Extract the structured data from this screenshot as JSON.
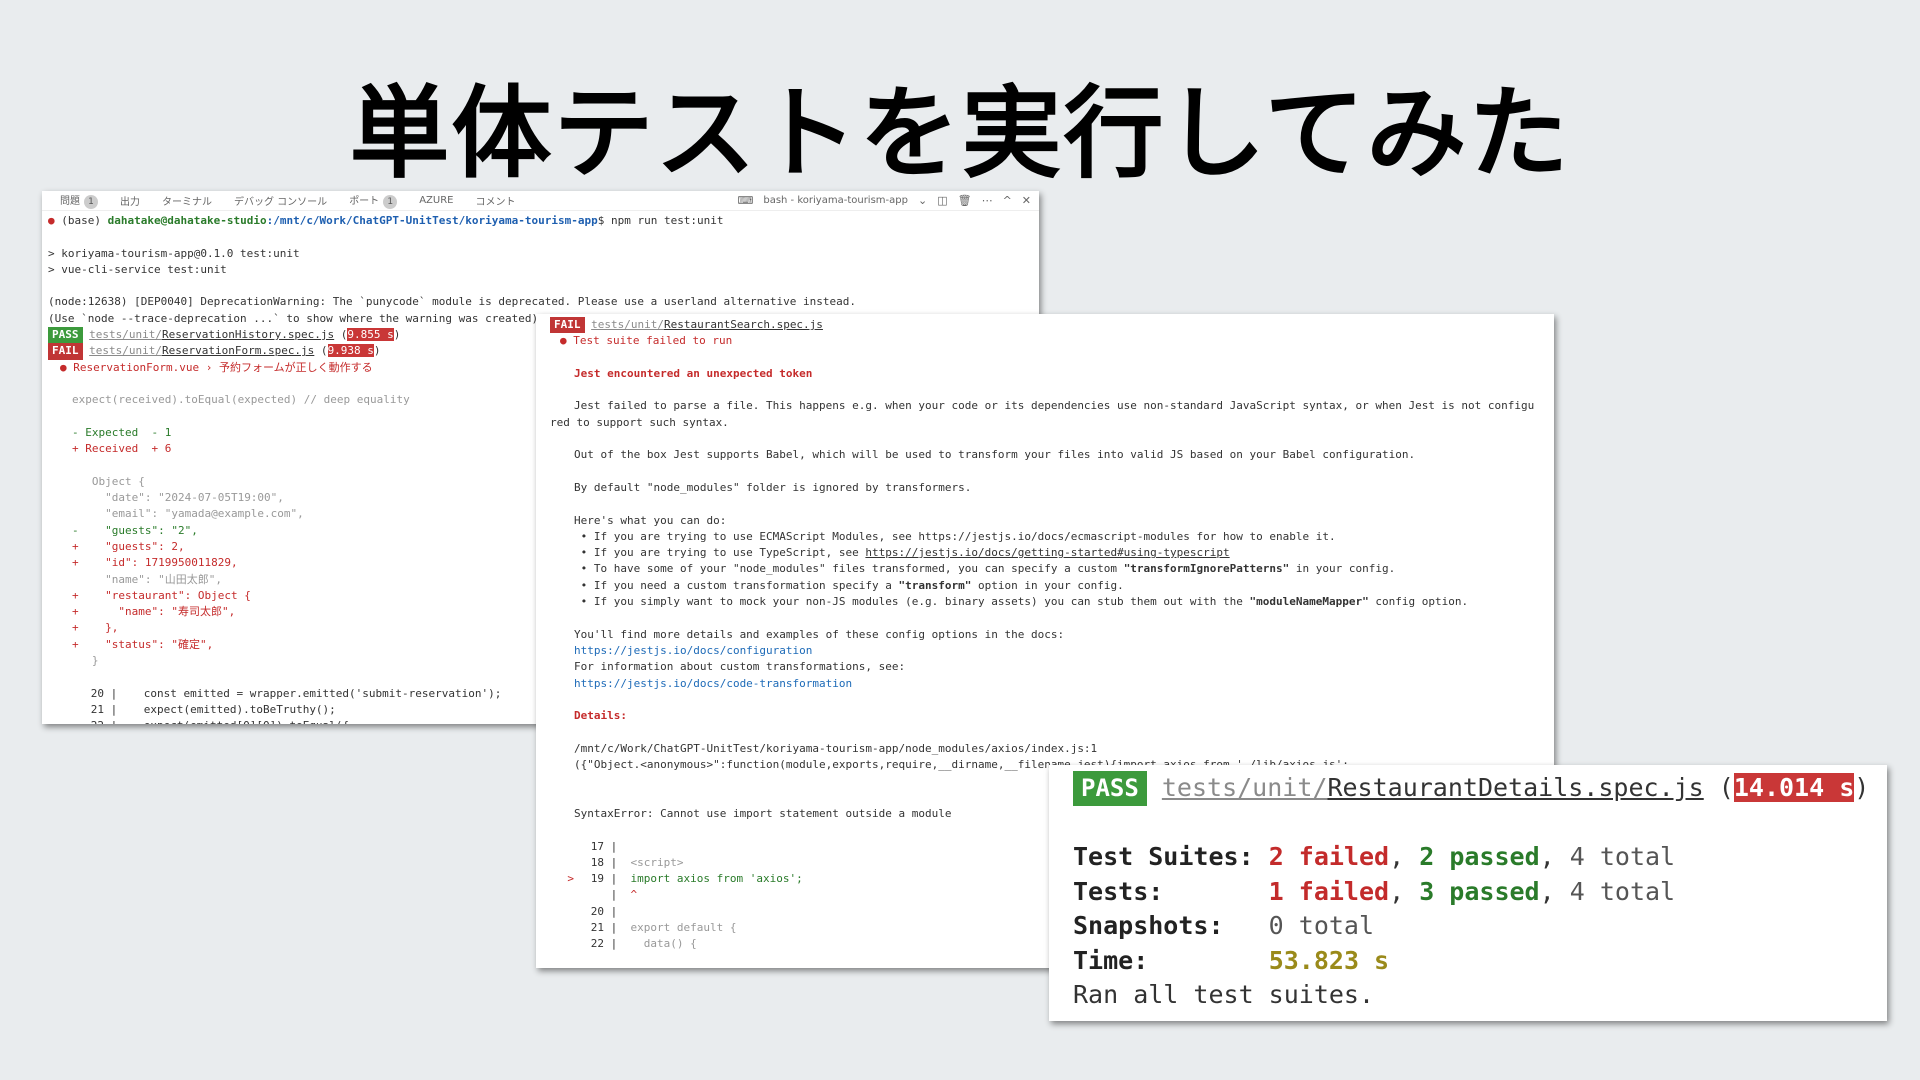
{
  "title": "単体テストを実行してみた",
  "shot1": {
    "tabs": [
      {
        "label": "問題",
        "count": "1"
      },
      {
        "label": "出力"
      },
      {
        "label": "ターミナル"
      },
      {
        "label": "デバッグ コンソール"
      },
      {
        "label": "ポート",
        "count": "1"
      },
      {
        "label": "AZURE"
      },
      {
        "label": "コメント"
      }
    ],
    "terminal_name": "bash - koriyama-tourism-app",
    "prompt_env": "(base)",
    "prompt_user": "dahatake@dahatake-studio",
    "prompt_path": ":/mnt/c/Work/ChatGPT-UnitTest/koriyama-tourism-app",
    "prompt_cmd": "$ npm run test:unit",
    "run_line1": "> koriyama-tourism-app@0.1.0 test:unit",
    "run_line2": "> vue-cli-service test:unit",
    "dep_line1": "(node:12638) [DEP0040] DeprecationWarning: The `punycode` module is deprecated. Please use a userland alternative instead.",
    "dep_line2": "(Use `node --trace-deprecation ...` to show where the warning was created)",
    "pass_label": "PASS",
    "fail_label": "FAIL",
    "pass_dir": "tests/unit/",
    "pass_file": "ReservationHistory.spec.js",
    "pass_time": "9.855 s",
    "fail_dir": "tests/unit/",
    "fail_file": "ReservationForm.spec.js",
    "fail_time": "9.938 s",
    "fail_test": "● ReservationForm.vue › 予約フォームが正しく動作する",
    "expect_line": "expect(received).toEqual(expected) // deep equality",
    "expected_label": "- Expected  - 1",
    "received_label": "+ Received  + 6",
    "obj": [
      {
        "p": " ",
        "t": "  Object {"
      },
      {
        "p": " ",
        "t": "    \"date\": \"2024-07-05T19:00\","
      },
      {
        "p": " ",
        "t": "    \"email\": \"yamada@example.com\","
      },
      {
        "p": "-",
        "t": "    \"guests\": \"2\","
      },
      {
        "p": "+",
        "t": "    \"guests\": 2,"
      },
      {
        "p": "+",
        "t": "    \"id\": 1719950011829,"
      },
      {
        "p": " ",
        "t": "    \"name\": \"山田太郎\","
      },
      {
        "p": "+",
        "t": "    \"restaurant\": Object {"
      },
      {
        "p": "+",
        "t": "      \"name\": \"寿司太郎\","
      },
      {
        "p": "+",
        "t": "    },"
      },
      {
        "p": "+",
        "t": "    \"status\": \"確定\","
      },
      {
        "p": " ",
        "t": "  }"
      }
    ],
    "code": [
      {
        "n": "20",
        "t": "const emitted = wrapper.emitted('submit-reservation');"
      },
      {
        "n": "21",
        "t": "expect(emitted).toBeTruthy();"
      },
      {
        "n": "22",
        "t": "expect(emitted[0][0]).toEqual({"
      }
    ]
  },
  "shot2": {
    "fail_label": "FAIL",
    "fail_dir": "tests/unit/",
    "fail_file": "RestaurantSearch.spec.js",
    "suite_failed": "● Test suite failed to run",
    "token_msg": "Jest encountered an unexpected token",
    "parse1": "Jest failed to parse a file. This happens e.g. when your code or its dependencies use non-standard JavaScript syntax, or when Jest is not configu",
    "parse2": "red to support such syntax.",
    "babel": "Out of the box Jest supports Babel, which will be used to transform your files into valid JS based on your Babel configuration.",
    "ignored": "By default \"node_modules\" folder is ignored by transformers.",
    "heres": "Here's what you can do:",
    "b1": " • If you are trying to use ECMAScript Modules, see https://jestjs.io/docs/ecmascript-modules for how to enable it.",
    "b2_pre": " • If you are trying to use TypeScript, see ",
    "b2_link": "https://jestjs.io/docs/getting-started#using-typescript",
    "b3_pre": " • To have some of your \"node_modules\" files transformed, you can specify a custom ",
    "b3_bold": "\"transformIgnorePatterns\"",
    "b3_post": " in your config.",
    "b4_pre": " • If you need a custom transformation specify a ",
    "b4_bold": "\"transform\"",
    "b4_post": " option in your config.",
    "b5_pre": " • If you simply want to mock your non-JS modules (e.g. binary assets) you can stub them out with the ",
    "b5_bold": "\"moduleNameMapper\"",
    "b5_post": " config option.",
    "more": "You'll find more details and examples of these config options in the docs:",
    "link1": "https://jestjs.io/docs/configuration",
    "forinfo": "For information about custom transformations, see:",
    "link2": "https://jestjs.io/docs/code-transformation",
    "details": "Details:",
    "path": "/mnt/c/Work/ChatGPT-UnitTest/koriyama-tourism-app/node_modules/axios/index.js:1",
    "fn": "({\"Object.<anonymous>\":function(module,exports,require,__dirname,__filename,jest){import axios from './lib/axios.js';",
    "syntax": "SyntaxError: Cannot use import statement outside a module",
    "code": [
      {
        "m": " ",
        "n": "17",
        "t": ""
      },
      {
        "m": " ",
        "n": "18",
        "t": "<script>"
      },
      {
        "m": ">",
        "n": "19",
        "t": "import axios from 'axios';"
      },
      {
        "m": " ",
        "n": "",
        "t": "^"
      },
      {
        "m": " ",
        "n": "20",
        "t": ""
      },
      {
        "m": " ",
        "n": "21",
        "t": "export default {"
      },
      {
        "m": " ",
        "n": "22",
        "t": "  data() {"
      }
    ]
  },
  "shot3": {
    "pass_label": "PASS",
    "dir": "tests/unit/",
    "file": "RestaurantDetails.spec.js",
    "time": "14.014 s",
    "suites_label": "Test Suites:",
    "suites_failed": "2 failed",
    "suites_passed": "2 passed",
    "suites_total": "4 total",
    "tests_label": "Tests:",
    "tests_failed": "1 failed",
    "tests_passed": "3 passed",
    "tests_total": "4 total",
    "snap_label": "Snapshots:",
    "snap_total": "0 total",
    "time_label": "Time:",
    "time_val": "53.823 s",
    "ran": "Ran all test suites."
  }
}
